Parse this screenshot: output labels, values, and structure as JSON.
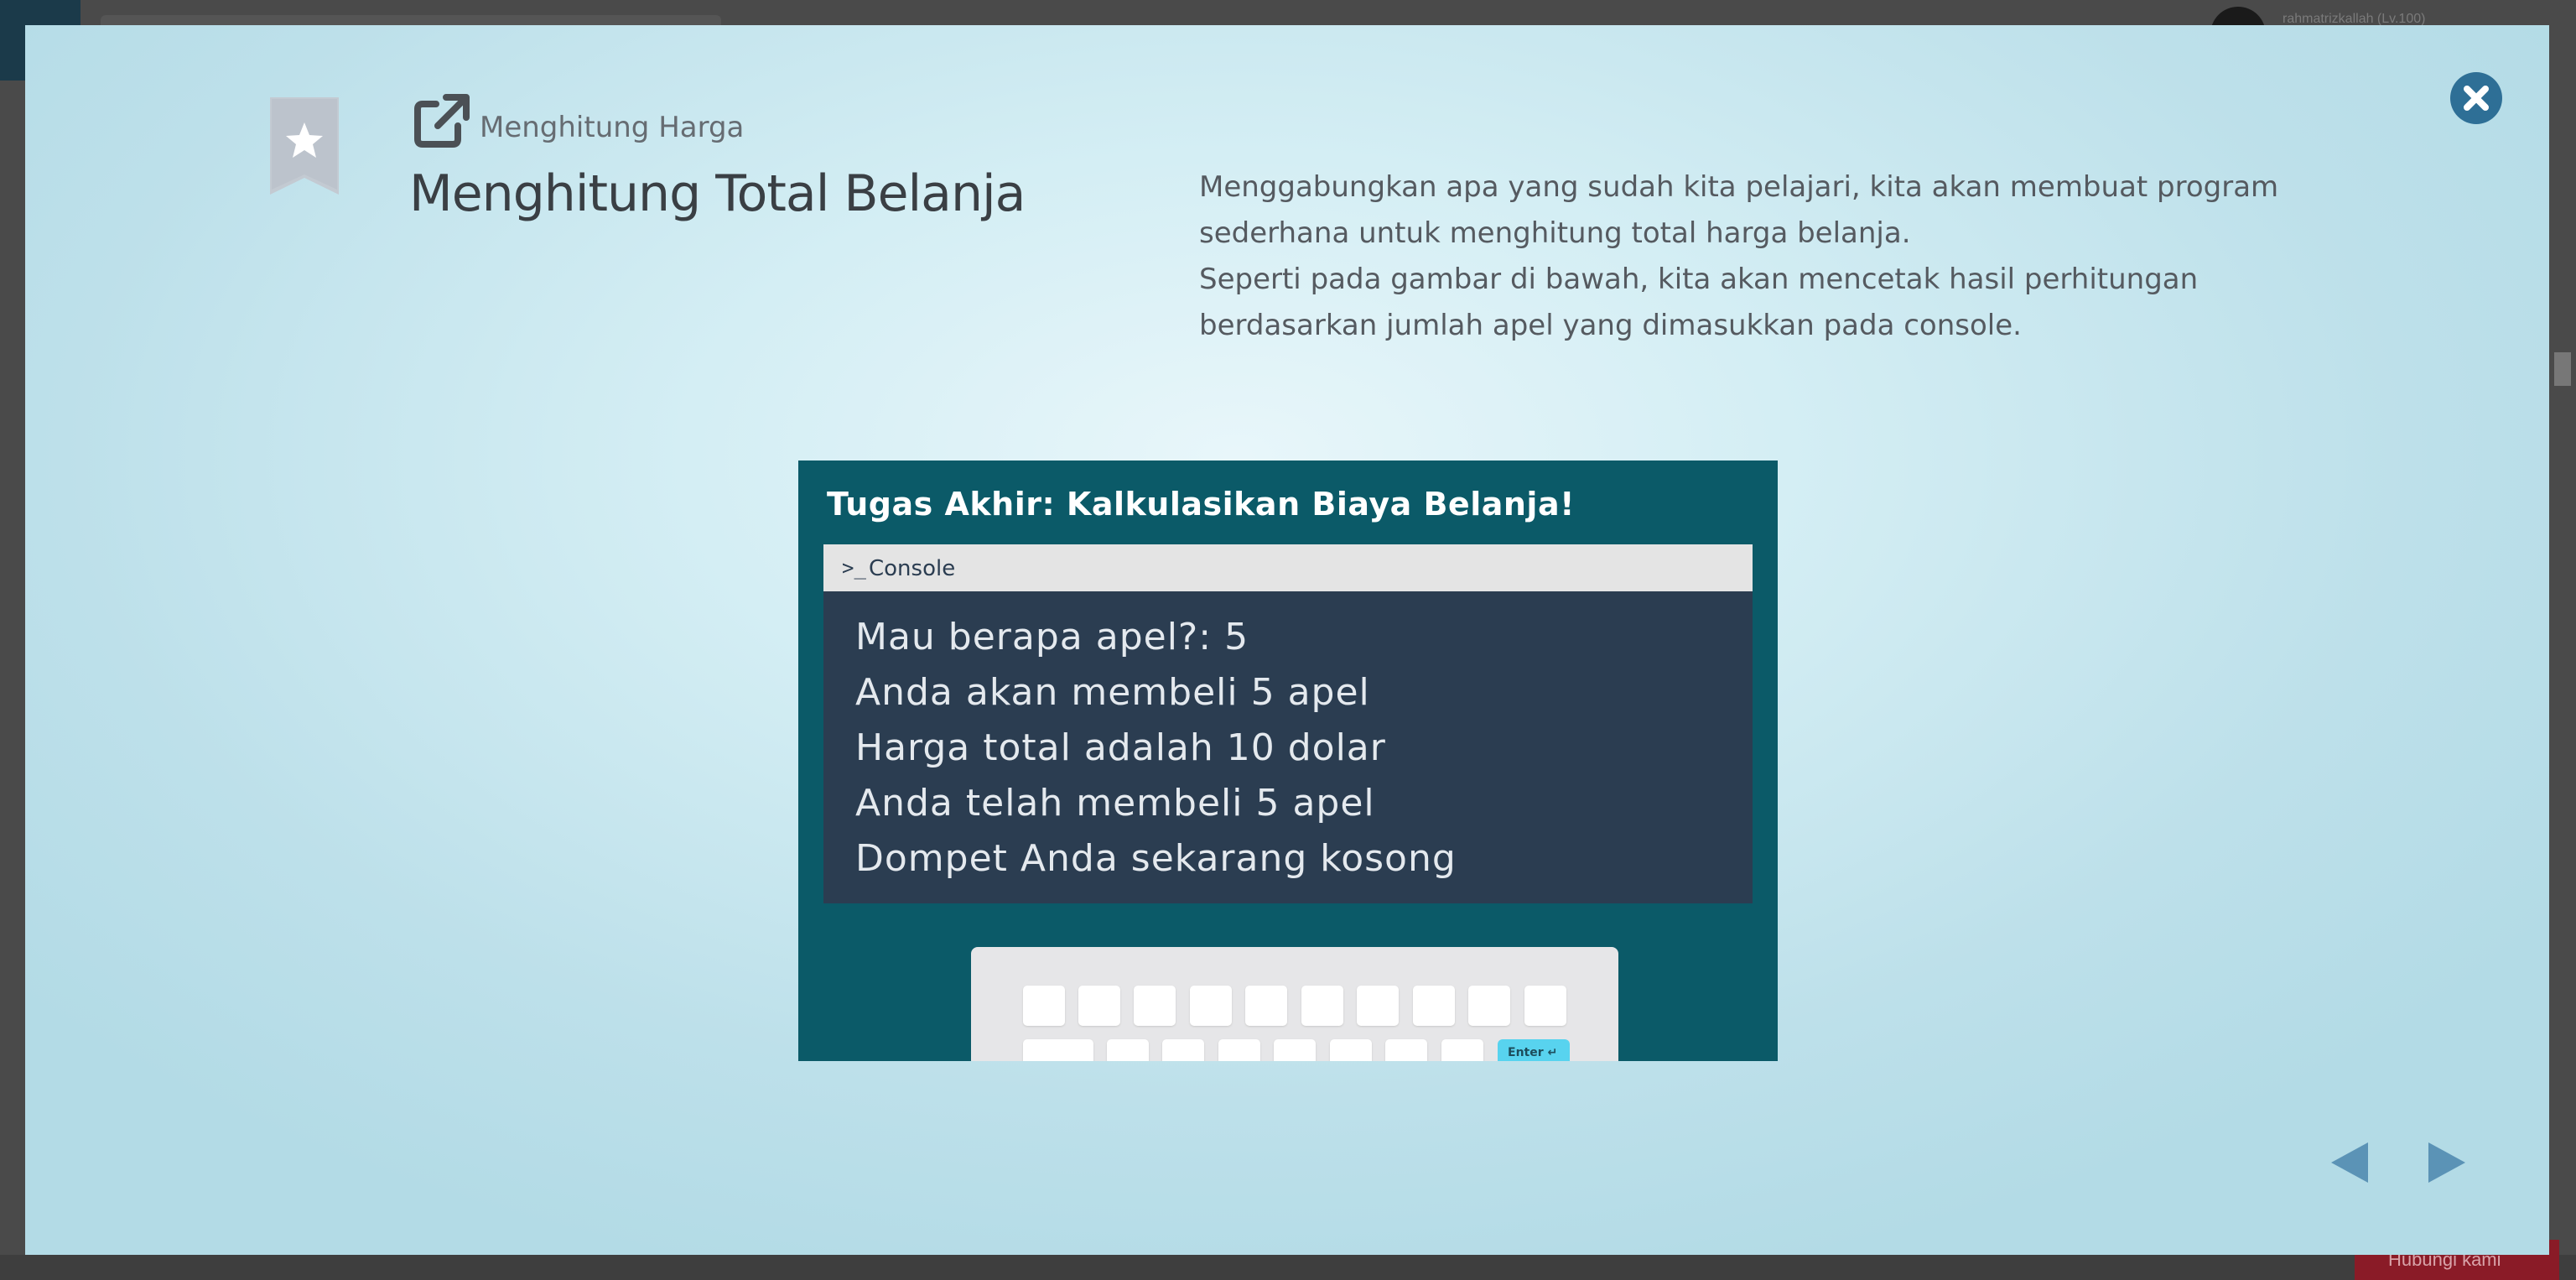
{
  "background": {
    "username": "rahmatrizkallah (Lv.100)",
    "bottom_button_label": "Hubungi kami"
  },
  "modal": {
    "subtitle": "Menghitung Harga",
    "title": "Menghitung Total Belanja",
    "description": [
      "Menggabungkan apa yang sudah kita pelajari, kita akan membuat program sederhana untuk menghitung total harga belanja.",
      "Seperti pada gambar di bawah, kita akan mencetak hasil perhitungan berdasarkan jumlah apel yang dimasukkan pada console."
    ],
    "icons": {
      "bookmark": "star-bookmark-icon",
      "external": "external-link-icon",
      "close": "close-icon",
      "prev": "arrow-left-icon",
      "next": "arrow-right-icon"
    },
    "colors": {
      "accent": "#2e6f96",
      "illustration_bg": "#0b5a68",
      "console_bg": "#2b3d51"
    }
  },
  "illustration": {
    "title": "Tugas Akhir: Kalkulasikan Biaya Belanja!",
    "console_prompt": ">_",
    "console_label": "Console",
    "console_lines": [
      "Mau berapa apel?: 5",
      "Anda akan membeli 5 apel",
      "Harga total adalah 10 dolar",
      "Anda telah membeli 5 apel",
      "Dompet Anda sekarang kosong"
    ],
    "enter_key_label": "Enter ↵"
  }
}
